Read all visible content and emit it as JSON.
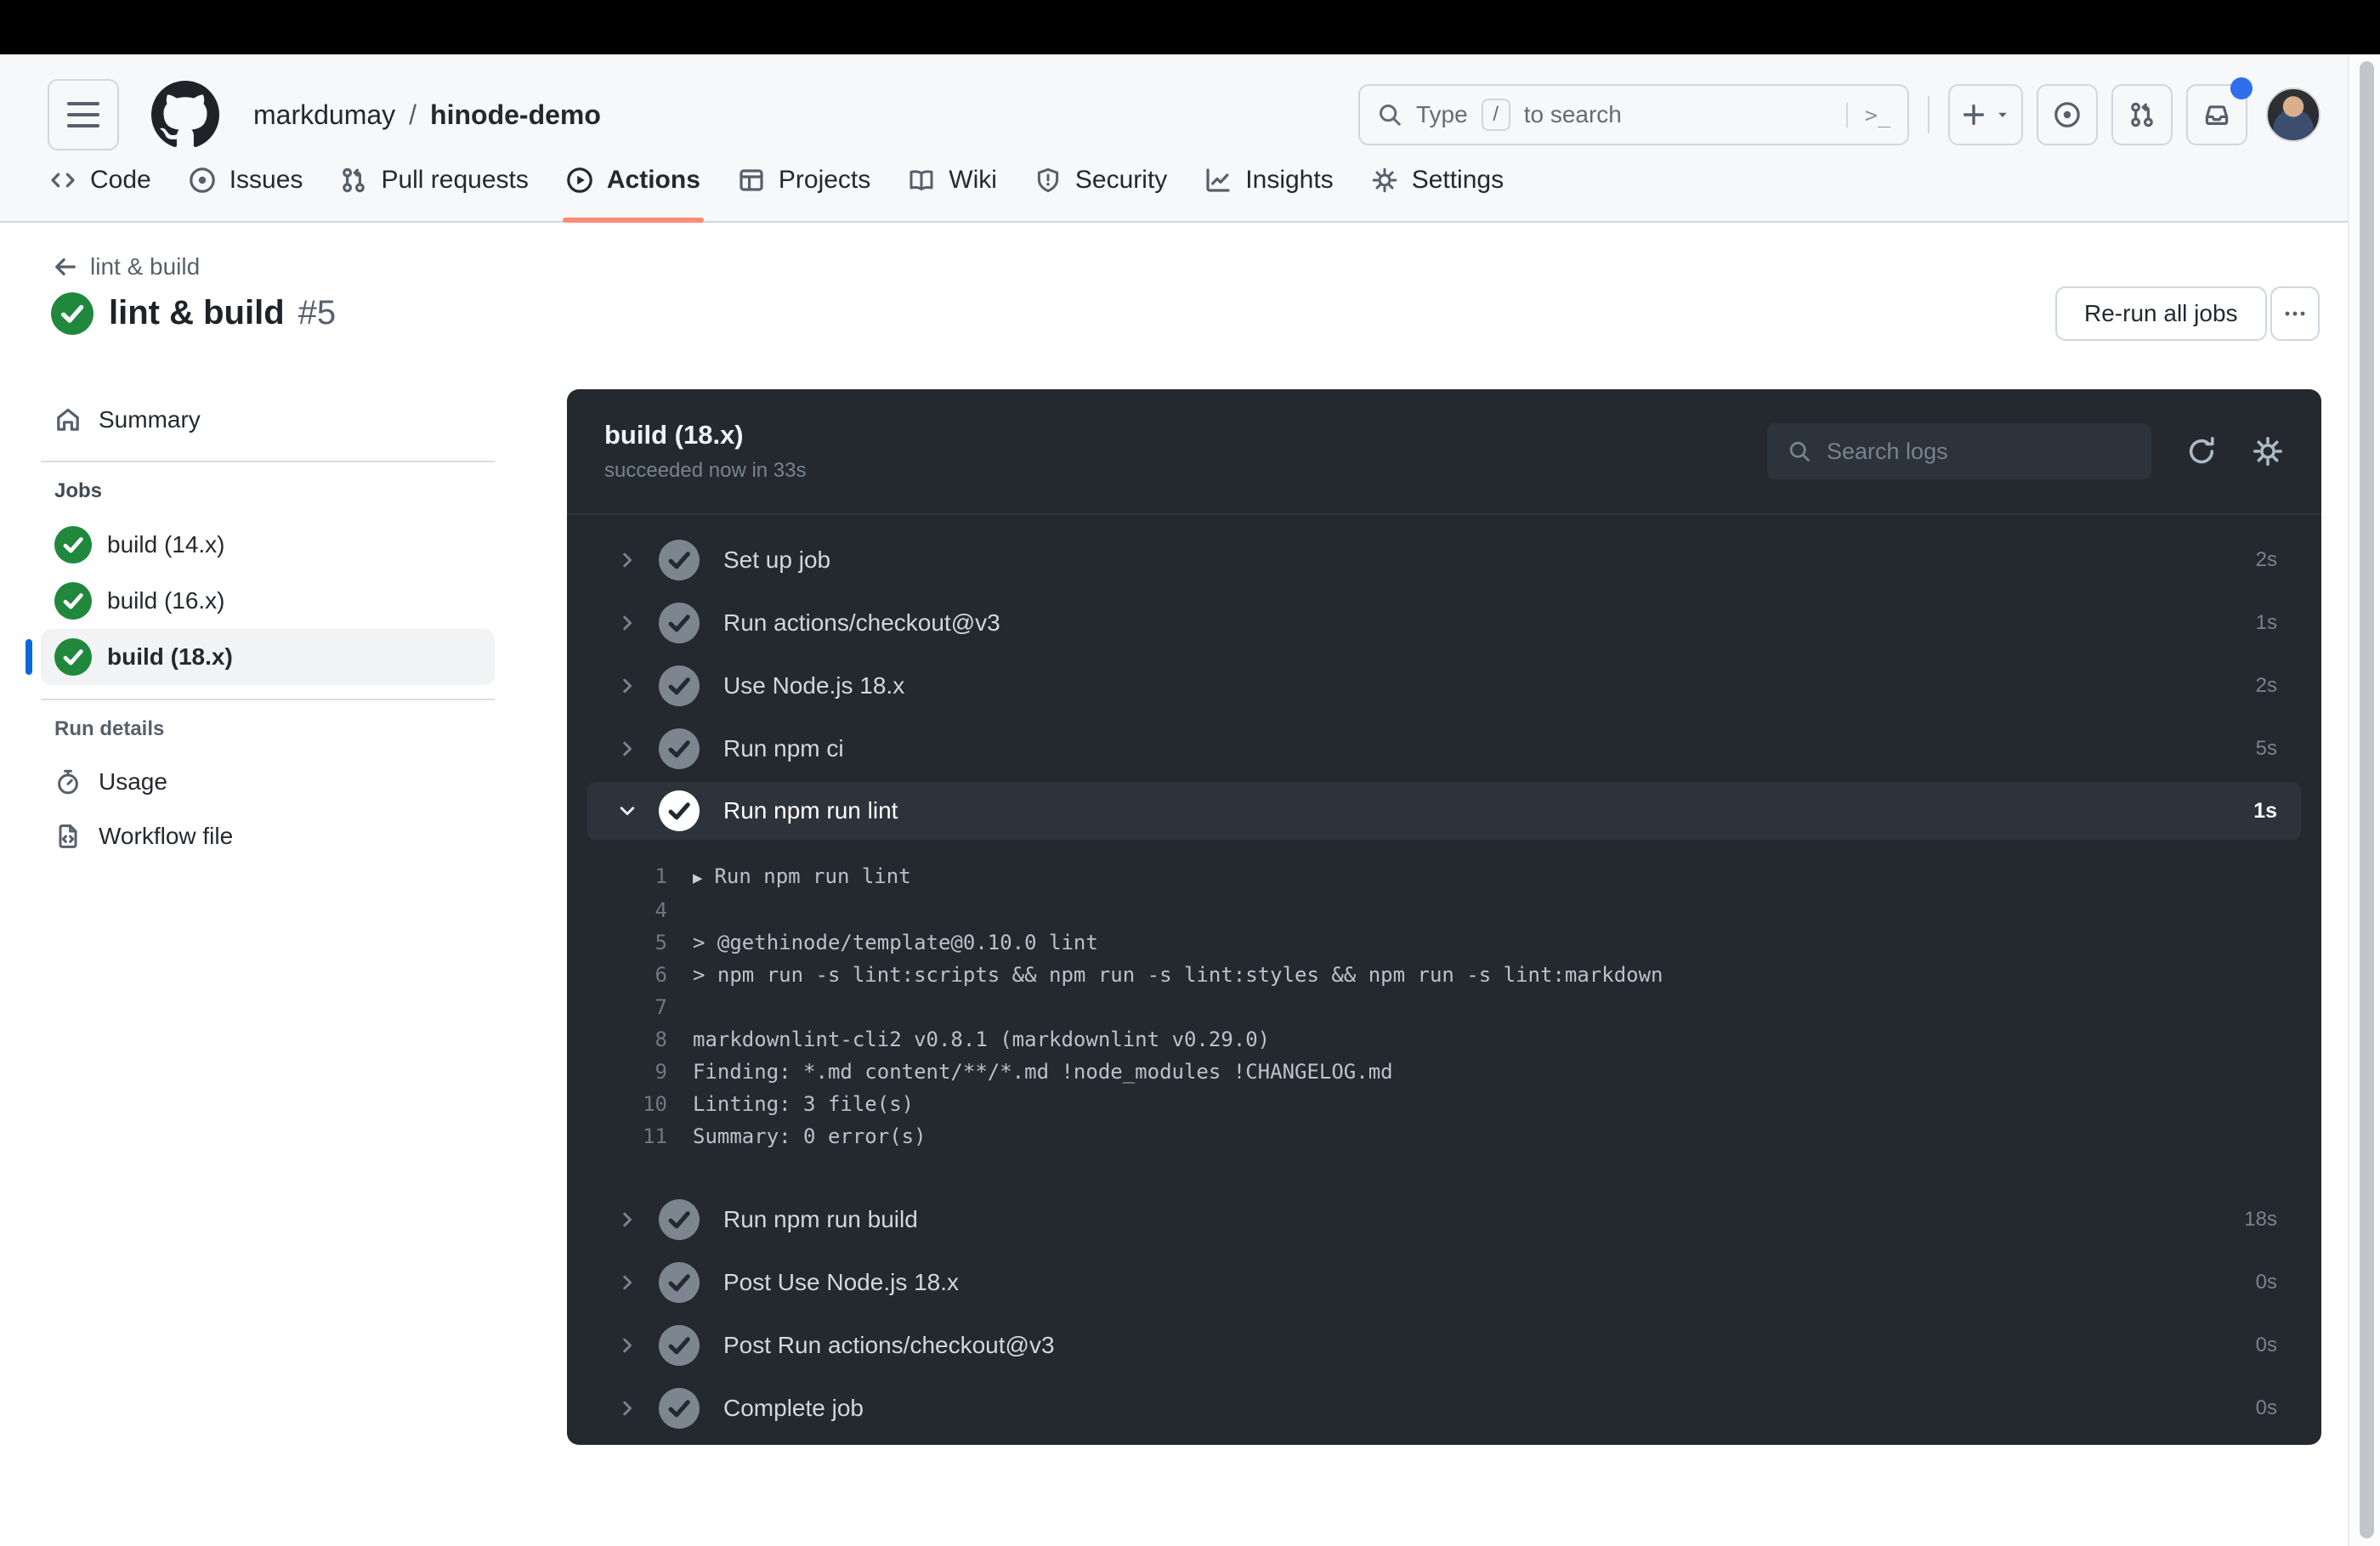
{
  "colors": {
    "accent-orange": "#fd8c73",
    "success-green": "#1f883d",
    "selected-blue": "#0969da",
    "notification-blue": "#2f6feb",
    "panel-bg": "#24292f",
    "panel-row-highlight": "#2d333b"
  },
  "header": {
    "breadcrumb": {
      "owner": "markdumay",
      "separator": "/",
      "repo": "hinode-demo"
    },
    "search": {
      "prefix": "Type",
      "slash_key": "/",
      "suffix": "to search",
      "terminal_hint": ">_"
    }
  },
  "nav": {
    "tabs": [
      {
        "label": "Code",
        "icon": "code",
        "active": false
      },
      {
        "label": "Issues",
        "icon": "circle-dot",
        "active": false
      },
      {
        "label": "Pull requests",
        "icon": "git-pull-request",
        "active": false
      },
      {
        "label": "Actions",
        "icon": "play-circle",
        "active": true
      },
      {
        "label": "Projects",
        "icon": "table",
        "active": false
      },
      {
        "label": "Wiki",
        "icon": "book",
        "active": false
      },
      {
        "label": "Security",
        "icon": "shield",
        "active": false
      },
      {
        "label": "Insights",
        "icon": "graph",
        "active": false
      },
      {
        "label": "Settings",
        "icon": "gear",
        "active": false
      }
    ]
  },
  "run": {
    "back_label": "lint & build",
    "title": "lint & build",
    "number": "#5",
    "status": "success",
    "rerun_button": "Re-run all jobs"
  },
  "sidebar": {
    "summary_label": "Summary",
    "jobs_heading": "Jobs",
    "jobs": [
      {
        "label": "build (14.x)",
        "status": "success",
        "selected": false
      },
      {
        "label": "build (16.x)",
        "status": "success",
        "selected": false
      },
      {
        "label": "build (18.x)",
        "status": "success",
        "selected": true
      }
    ],
    "run_details_heading": "Run details",
    "run_details": [
      {
        "label": "Usage",
        "icon": "stopwatch"
      },
      {
        "label": "Workflow file",
        "icon": "file-code"
      }
    ]
  },
  "panel": {
    "title": "build (18.x)",
    "subtitle": "succeeded now in 33s",
    "log_search_placeholder": "Search logs",
    "steps": [
      {
        "name": "Set up job",
        "duration": "2s",
        "expanded": false
      },
      {
        "name": "Run actions/checkout@v3",
        "duration": "1s",
        "expanded": false
      },
      {
        "name": "Use Node.js 18.x",
        "duration": "2s",
        "expanded": false
      },
      {
        "name": "Run npm ci",
        "duration": "5s",
        "expanded": false
      },
      {
        "name": "Run npm run lint",
        "duration": "1s",
        "expanded": true,
        "log_lines": [
          {
            "num": "1",
            "text": "Run npm run lint",
            "group": true
          },
          {
            "num": "4",
            "text": ""
          },
          {
            "num": "5",
            "text": "> @gethinode/template@0.10.0 lint"
          },
          {
            "num": "6",
            "text": "> npm run -s lint:scripts && npm run -s lint:styles && npm run -s lint:markdown"
          },
          {
            "num": "7",
            "text": ""
          },
          {
            "num": "8",
            "text": "markdownlint-cli2 v0.8.1 (markdownlint v0.29.0)"
          },
          {
            "num": "9",
            "text": "Finding: *.md content/**/*.md !node_modules !CHANGELOG.md"
          },
          {
            "num": "10",
            "text": "Linting: 3 file(s)"
          },
          {
            "num": "11",
            "text": "Summary: 0 error(s)"
          }
        ]
      },
      {
        "name": "Run npm run build",
        "duration": "18s",
        "expanded": false
      },
      {
        "name": "Post Use Node.js 18.x",
        "duration": "0s",
        "expanded": false
      },
      {
        "name": "Post Run actions/checkout@v3",
        "duration": "0s",
        "expanded": false
      },
      {
        "name": "Complete job",
        "duration": "0s",
        "expanded": false
      }
    ]
  }
}
